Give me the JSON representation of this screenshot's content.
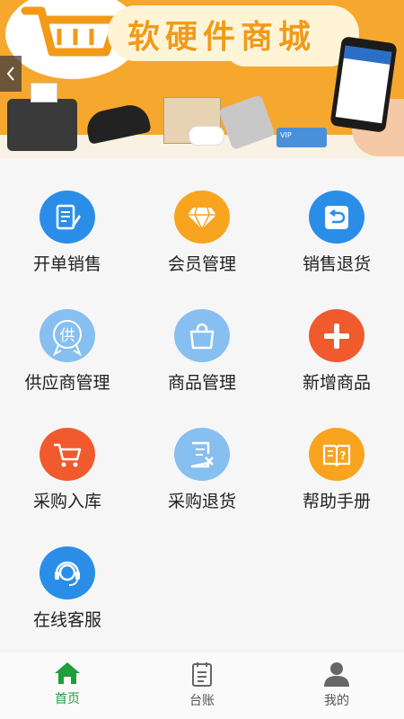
{
  "banner": {
    "title": "软硬件商城",
    "card_text": "VIP"
  },
  "grid": {
    "items": [
      {
        "label": "开单销售",
        "icon": "document-edit-icon",
        "color": "#2a8ee8"
      },
      {
        "label": "会员管理",
        "icon": "diamond-icon",
        "color": "#f8a41f"
      },
      {
        "label": "销售退货",
        "icon": "return-box-icon",
        "color": "#2a8ee8"
      },
      {
        "label": "供应商管理",
        "icon": "supplier-badge-icon",
        "color": "#86bff0"
      },
      {
        "label": "商品管理",
        "icon": "shopping-bag-icon",
        "color": "#86bff0"
      },
      {
        "label": "新增商品",
        "icon": "plus-icon",
        "color": "#f05a2d"
      },
      {
        "label": "采购入库",
        "icon": "cart-icon",
        "color": "#f05a2d"
      },
      {
        "label": "采购退货",
        "icon": "purchase-return-icon",
        "color": "#86bff0"
      },
      {
        "label": "帮助手册",
        "icon": "help-book-icon",
        "color": "#f8a41f"
      },
      {
        "label": "在线客服",
        "icon": "customer-service-icon",
        "color": "#2a8ee8"
      }
    ]
  },
  "tabbar": {
    "tabs": [
      {
        "label": "首页",
        "icon": "home-icon",
        "active": true
      },
      {
        "label": "台账",
        "icon": "ledger-icon",
        "active": false
      },
      {
        "label": "我的",
        "icon": "user-icon",
        "active": false
      }
    ],
    "active_color": "#1f9e3a"
  },
  "supplier_glyph": "供"
}
